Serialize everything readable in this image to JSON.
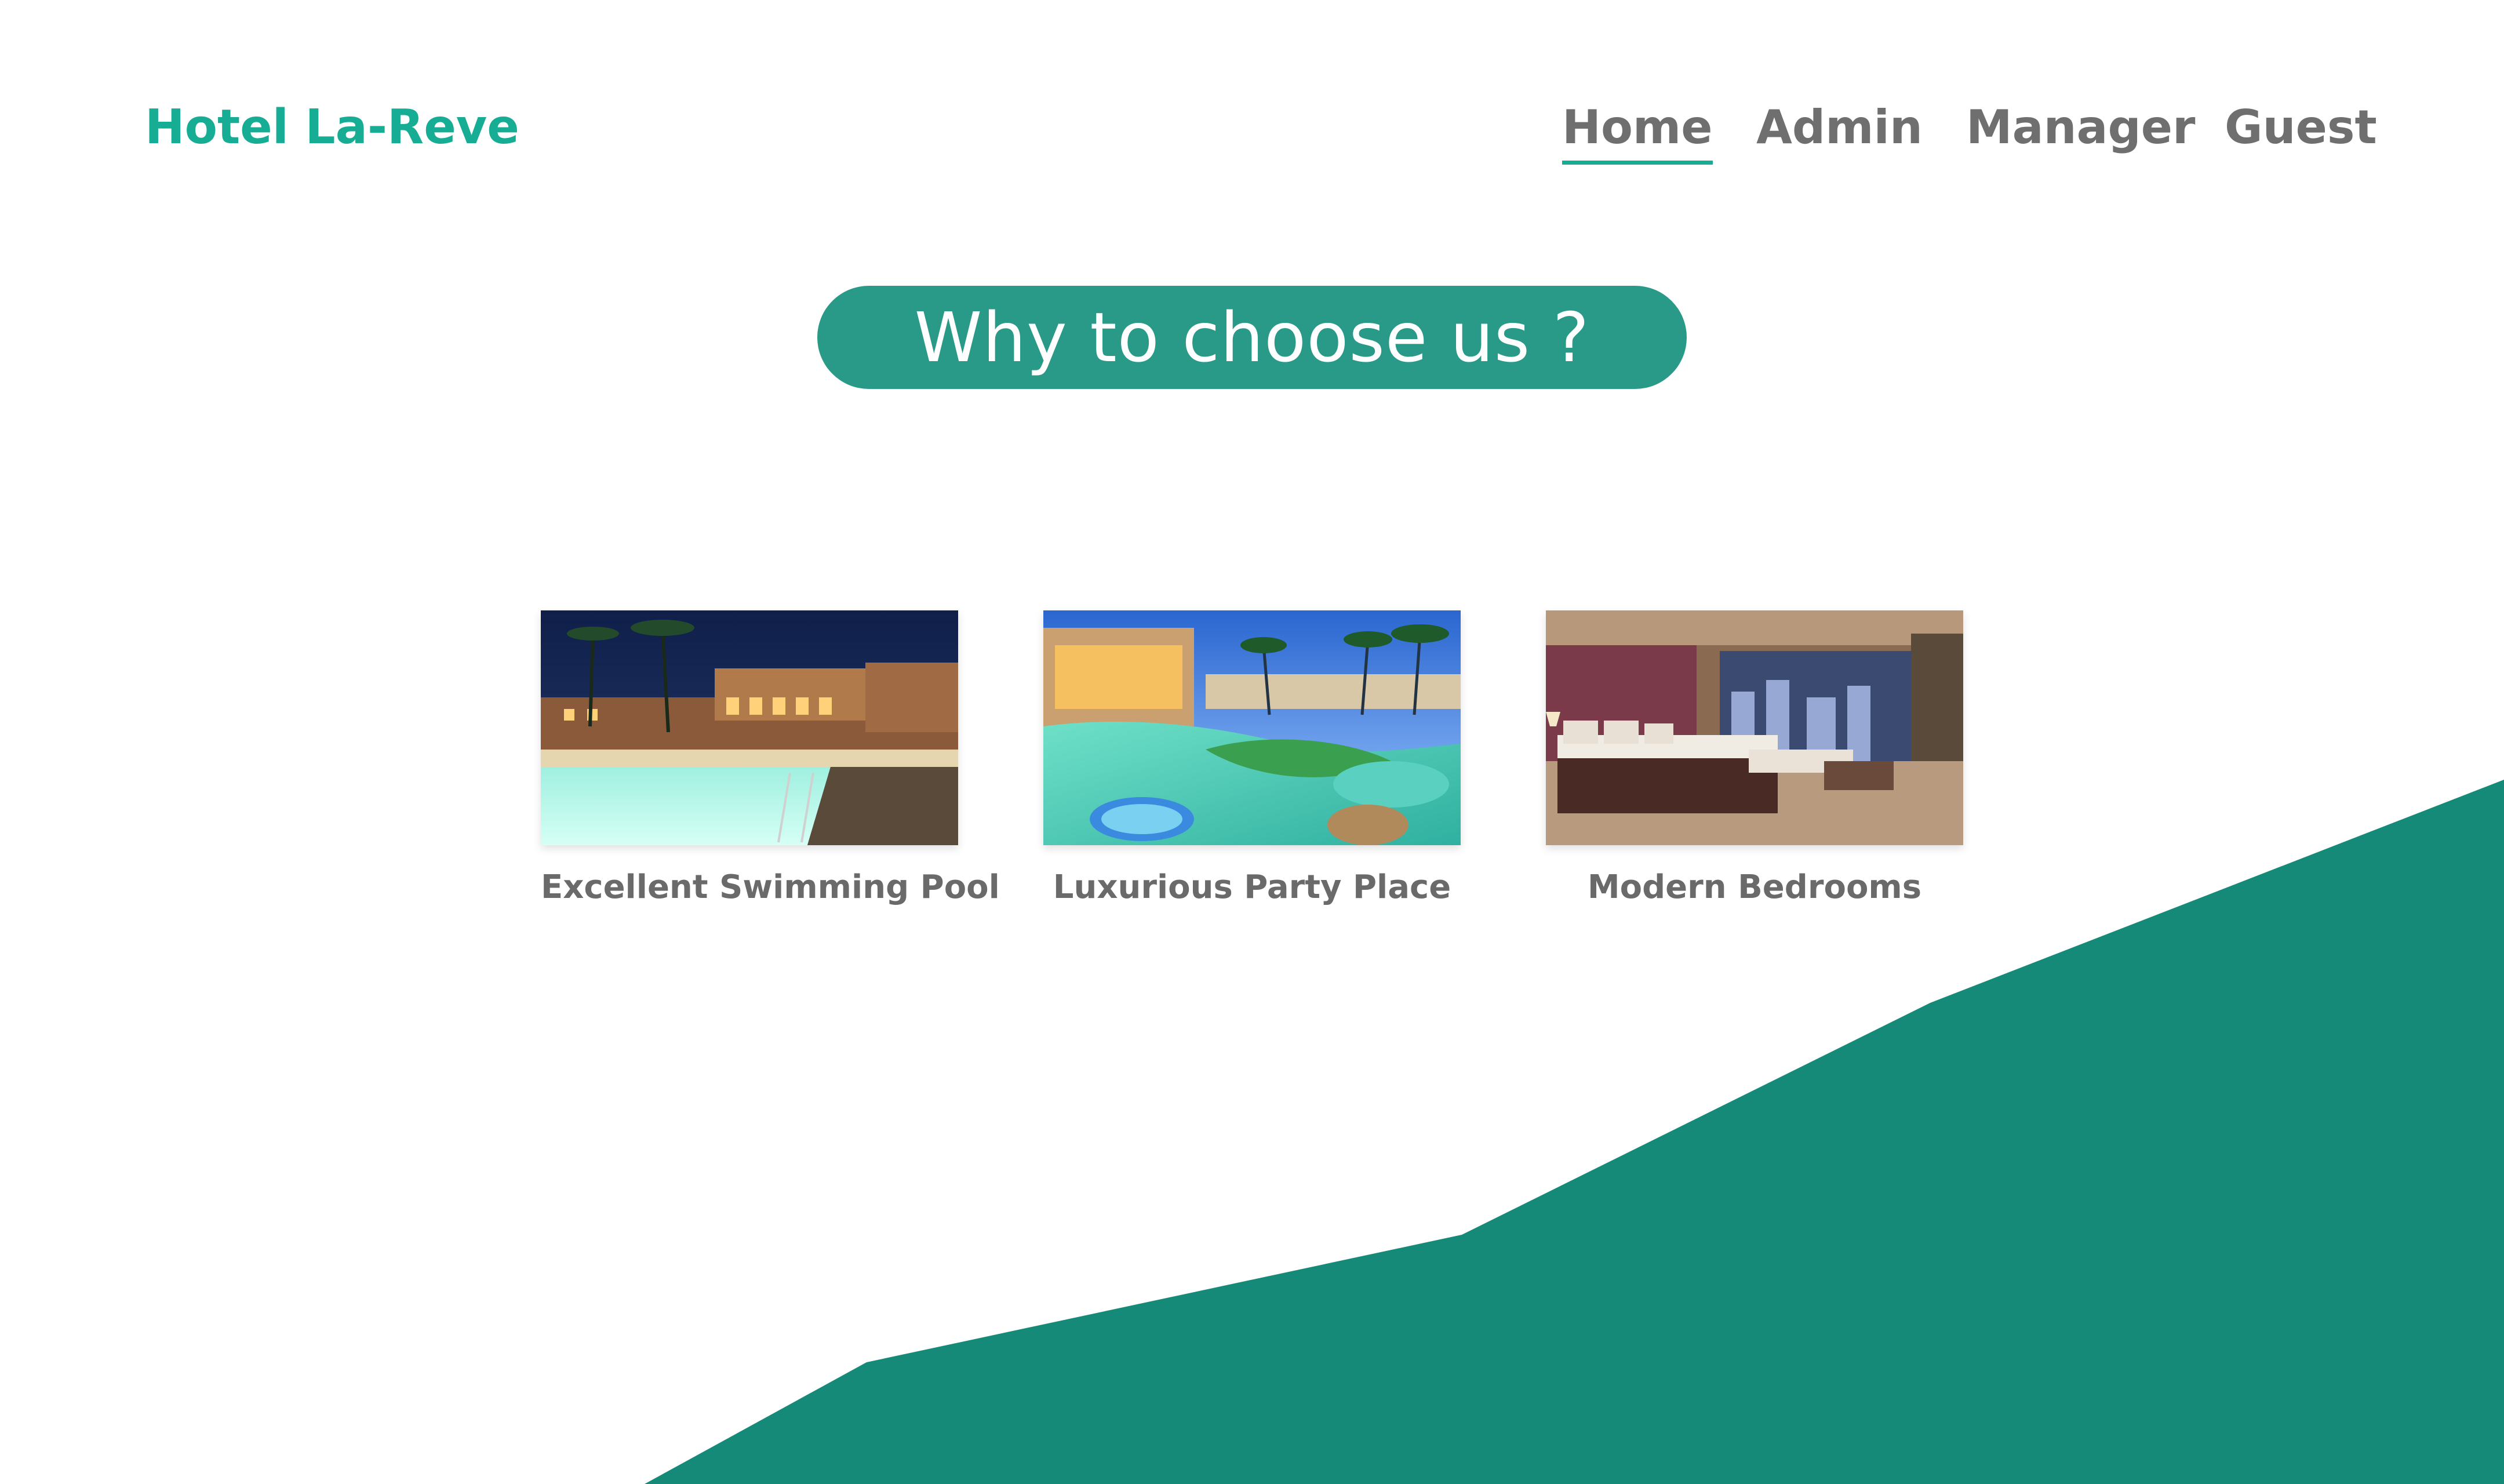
{
  "header": {
    "brand": "Hotel La-Reve",
    "nav": [
      {
        "label": "Home",
        "active": true
      },
      {
        "label": "Admin",
        "active": false
      },
      {
        "label": "Manager",
        "active": false
      },
      {
        "label": "Guest",
        "active": false
      }
    ]
  },
  "hero": {
    "heading": "Why to choose us ?"
  },
  "features": [
    {
      "label": "Excellent Swimming Pool",
      "image": "swimming-pool-photo"
    },
    {
      "label": "Luxurious Party Place",
      "image": "party-place-photo"
    },
    {
      "label": "Modern Bedrooms",
      "image": "bedroom-photo"
    }
  ],
  "colors": {
    "brand": "#16ad94",
    "pill": "#2a9a88",
    "decor": "#168a78",
    "nav_text": "#6f6f6f",
    "label_text": "#6a6a6a"
  }
}
